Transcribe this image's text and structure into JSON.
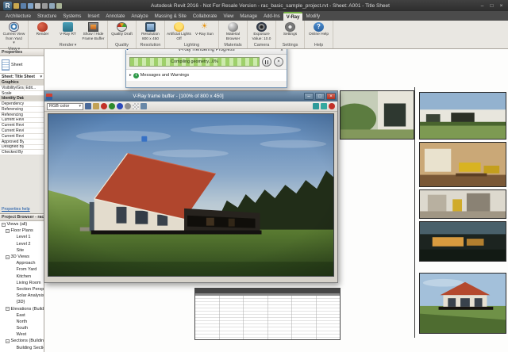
{
  "window": {
    "title": "Autodesk Revit 2016 - Not For Resale Version -   rac_basic_sample_project.rvt - Sheet: A001 - Title Sheet"
  },
  "icons": {
    "chevron_down": "▾",
    "close": "×",
    "minimize": "–",
    "maximize": "□",
    "expander": "▸",
    "info_i": "i",
    "question": "?",
    "sun": "☀",
    "revit_r": "R"
  },
  "ribbon": {
    "tabs": [
      {
        "label": "Architecture"
      },
      {
        "label": "Structure"
      },
      {
        "label": "Systems"
      },
      {
        "label": "Insert"
      },
      {
        "label": "Annotate"
      },
      {
        "label": "Analyze"
      },
      {
        "label": "Massing & Site"
      },
      {
        "label": "Collaborate"
      },
      {
        "label": "View"
      },
      {
        "label": "Manage"
      },
      {
        "label": "Add-Ins"
      },
      {
        "label": "V-Ray",
        "cls": "active"
      },
      {
        "label": "Modify"
      }
    ],
    "view_group": {
      "label": "View",
      "button": "Current View from Yard"
    },
    "render_group": {
      "label": "Render",
      "button1": "Render",
      "button2": "V-Ray RT",
      "button3": "Show / Hide Frame Buffer"
    },
    "quality_group": {
      "label": "Quality",
      "button": "Quality Draft"
    },
    "resolution_group": {
      "label": "Resolution",
      "button": "Resolution 800 x 450"
    },
    "lighting_group": {
      "label": "Lighting",
      "button1": "Artificial Lights Off",
      "button2": "V-Ray Sun"
    },
    "materials_group": {
      "label": "Materials",
      "button": "Material Browser"
    },
    "camera_group": {
      "label": "Camera",
      "button": "Exposure Value: 10.0"
    },
    "settings_group": {
      "label": "Settings",
      "button": "Settings"
    },
    "help_group": {
      "label": "Help",
      "button": "Online Help"
    }
  },
  "properties": {
    "title": "Properties",
    "type_name": "Sheet",
    "instance_name": "Sheet: Title Sheet",
    "rows": [
      {
        "label": "Graphics",
        "value": "",
        "cls": "hdr"
      },
      {
        "label": "Visibility/Graph...",
        "value": "Edit..."
      },
      {
        "label": "Scale",
        "value": ""
      },
      {
        "label": "Identity Data",
        "value": "",
        "cls": "hdr"
      },
      {
        "label": "Dependency",
        "value": ""
      },
      {
        "label": "Referencing Sh...",
        "value": ""
      },
      {
        "label": "Referencing De...",
        "value": ""
      },
      {
        "label": "Current Revisio...",
        "value": ""
      },
      {
        "label": "Current Revisio...",
        "value": ""
      },
      {
        "label": "Current Revisio...",
        "value": ""
      },
      {
        "label": "Current Revisio...",
        "value": ""
      },
      {
        "label": "Approved By",
        "value": ""
      },
      {
        "label": "Designed By",
        "value": ""
      },
      {
        "label": "Checked By",
        "value": ""
      }
    ],
    "help_link": "Properties help"
  },
  "project_browser": {
    "title": "Project Browser - rac_basic_sam...",
    "items": [
      {
        "label": "Views (all)",
        "cls": "l0",
        "exp": "−"
      },
      {
        "label": "Floor Plans",
        "cls": "l1",
        "exp": "−"
      },
      {
        "label": "Level 1",
        "cls": "l2",
        "exp": ""
      },
      {
        "label": "Level 2",
        "cls": "l2",
        "exp": ""
      },
      {
        "label": "Site",
        "cls": "l2",
        "exp": ""
      },
      {
        "label": "3D Views",
        "cls": "l1",
        "exp": "−"
      },
      {
        "label": "Approach",
        "cls": "l2",
        "exp": ""
      },
      {
        "label": "From Yard",
        "cls": "l2",
        "exp": ""
      },
      {
        "label": "Kitchen",
        "cls": "l2",
        "exp": ""
      },
      {
        "label": "Living Room",
        "cls": "l2",
        "exp": ""
      },
      {
        "label": "Section Perspective",
        "cls": "l2",
        "exp": ""
      },
      {
        "label": "Solar Analysis",
        "cls": "l2",
        "exp": ""
      },
      {
        "label": "{3D}",
        "cls": "l2",
        "exp": ""
      },
      {
        "label": "Elevations (Building Elevation)",
        "cls": "l1",
        "exp": "−"
      },
      {
        "label": "East",
        "cls": "l2",
        "exp": ""
      },
      {
        "label": "North",
        "cls": "l2",
        "exp": ""
      },
      {
        "label": "South",
        "cls": "l2",
        "exp": ""
      },
      {
        "label": "West",
        "cls": "l2",
        "exp": ""
      },
      {
        "label": "Sections (Building Section)",
        "cls": "l1",
        "exp": "−"
      },
      {
        "label": "Building Section",
        "cls": "l2",
        "exp": ""
      }
    ]
  },
  "progress_dialog": {
    "title": "V-Ray Rendering Progress",
    "progress_text": "Compiling geometry...0%",
    "messages_label": "Messages and Warnings"
  },
  "frame_buffer": {
    "title": "V-Ray frame buffer - [100% of 800 x 450]",
    "channel_selector": "RGB color",
    "toolbar_icons": [
      {
        "cls": "ic-save",
        "name": "save-image-icon"
      },
      {
        "cls": "ic-load",
        "name": "load-image-icon"
      },
      {
        "cls": "ic-red",
        "name": "red-channel-icon"
      },
      {
        "cls": "ic-green",
        "name": "green-channel-icon"
      },
      {
        "cls": "ic-blue",
        "name": "blue-channel-icon"
      },
      {
        "cls": "ic-mono",
        "name": "monochrome-icon"
      },
      {
        "cls": "ic-alpha",
        "name": "alpha-channel-icon"
      },
      {
        "cls": "ic-info2",
        "name": "image-info-icon"
      }
    ],
    "toolbar_icons_right": [
      {
        "cls": "ic-region",
        "name": "region-render-icon"
      },
      {
        "cls": "ic-teal2",
        "name": "track-mouse-icon"
      },
      {
        "cls": "ic-stop",
        "name": "stop-render-icon"
      }
    ]
  }
}
